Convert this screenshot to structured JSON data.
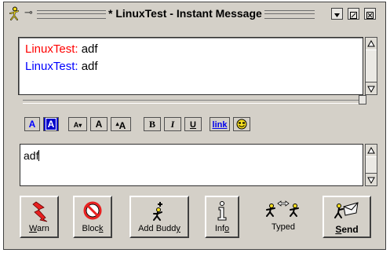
{
  "window": {
    "title": "* LinuxTest - Instant Message"
  },
  "conversation": {
    "messages": [
      {
        "sender": "LinuxTest:",
        "text": "adf",
        "color": "#ff0000"
      },
      {
        "sender": "LinuxTest:",
        "text": "adf",
        "color": "#0000ff"
      }
    ]
  },
  "toolbar": {
    "text_color_label": "A",
    "bg_color_label": "A",
    "font_face_label": "A",
    "font_size_label": "A",
    "font_bigger_label": "A",
    "bold_label": "B",
    "italic_label": "I",
    "underline_label": "U",
    "link_label": "link",
    "smiley_icon": "smiley-icon"
  },
  "compose": {
    "value": "adf"
  },
  "buttons": {
    "warn": {
      "label_pre": "",
      "label_u": "W",
      "label_post": "arn"
    },
    "block": {
      "label_pre": "Bloc",
      "label_u": "k",
      "label_post": ""
    },
    "add_buddy": {
      "label_pre": "Add Budd",
      "label_u": "y",
      "label_post": ""
    },
    "info": {
      "label_pre": "Inf",
      "label_u": "o",
      "label_post": ""
    },
    "typed": {
      "label": "Typed"
    },
    "send": {
      "label_pre": "",
      "label_u": "S",
      "label_post": "end"
    }
  },
  "colors": {
    "accent_red": "#ff0000",
    "accent_blue": "#0000ff",
    "chrome": "#d4d0c8",
    "link_blue": "#0000ee",
    "smiley_yellow": "#f8e020"
  }
}
